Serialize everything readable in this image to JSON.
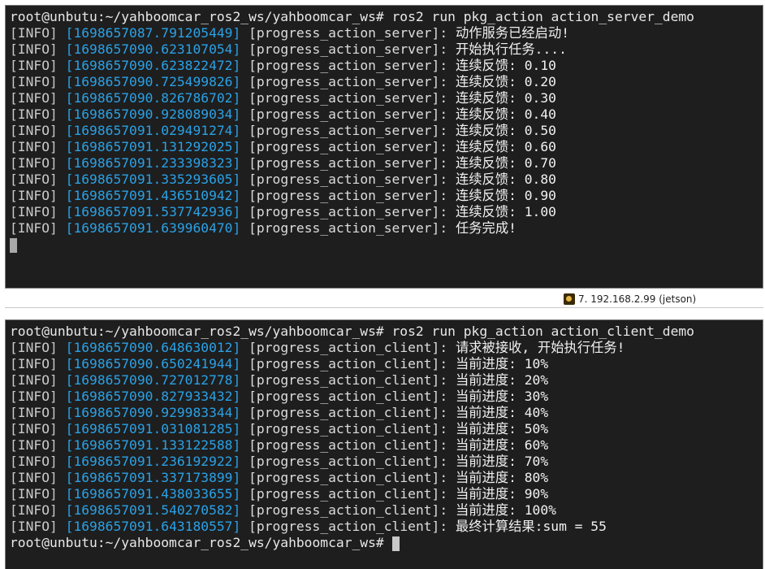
{
  "server": {
    "prompt": "root@unbutu:~/yahboomcar_ros2_ws/yahboomcar_ws#",
    "command": " ros2 run pkg_action action_server_demo",
    "node_name": "[progress_action_server]:",
    "level": "[INFO]",
    "logs": [
      {
        "ts": "[1698657087.791205449]",
        "msg": "动作服务已经启动!"
      },
      {
        "ts": "[1698657090.623107054]",
        "msg": "开始执行任务...."
      },
      {
        "ts": "[1698657090.623822472]",
        "msg": "连续反馈: 0.10"
      },
      {
        "ts": "[1698657090.725499826]",
        "msg": "连续反馈: 0.20"
      },
      {
        "ts": "[1698657090.826786702]",
        "msg": "连续反馈: 0.30"
      },
      {
        "ts": "[1698657090.928089034]",
        "msg": "连续反馈: 0.40"
      },
      {
        "ts": "[1698657091.029491274]",
        "msg": "连续反馈: 0.50"
      },
      {
        "ts": "[1698657091.131292025]",
        "msg": "连续反馈: 0.60"
      },
      {
        "ts": "[1698657091.233398323]",
        "msg": "连续反馈: 0.70"
      },
      {
        "ts": "[1698657091.335293605]",
        "msg": "连续反馈: 0.80"
      },
      {
        "ts": "[1698657091.436510942]",
        "msg": "连续反馈: 0.90"
      },
      {
        "ts": "[1698657091.537742936]",
        "msg": "连续反馈: 1.00"
      },
      {
        "ts": "[1698657091.639960470]",
        "msg": "任务完成!"
      }
    ]
  },
  "statusbar": {
    "session_label": "7. 192.168.2.99 (jetson)",
    "session_icon": "key-icon"
  },
  "client": {
    "prompt": "root@unbutu:~/yahboomcar_ros2_ws/yahboomcar_ws#",
    "command": " ros2 run pkg_action action_client_demo",
    "node_name": "[progress_action_client]:",
    "level": "[INFO]",
    "logs": [
      {
        "ts": "[1698657090.648630012]",
        "msg": "请求被接收, 开始执行任务!"
      },
      {
        "ts": "[1698657090.650241944]",
        "msg": "当前进度: 10%"
      },
      {
        "ts": "[1698657090.727012778]",
        "msg": "当前进度: 20%"
      },
      {
        "ts": "[1698657090.827933432]",
        "msg": "当前进度: 30%"
      },
      {
        "ts": "[1698657090.929983344]",
        "msg": "当前进度: 40%"
      },
      {
        "ts": "[1698657091.031081285]",
        "msg": "当前进度: 50%"
      },
      {
        "ts": "[1698657091.133122588]",
        "msg": "当前进度: 60%"
      },
      {
        "ts": "[1698657091.236192922]",
        "msg": "当前进度: 70%"
      },
      {
        "ts": "[1698657091.337173899]",
        "msg": "当前进度: 80%"
      },
      {
        "ts": "[1698657091.438033655]",
        "msg": "当前进度: 90%"
      },
      {
        "ts": "[1698657091.540270582]",
        "msg": "当前进度: 100%"
      },
      {
        "ts": "[1698657091.643180557]",
        "msg": "最终计算结果:sum = 55"
      }
    ],
    "final_prompt": "root@unbutu:~/yahboomcar_ros2_ws/yahboomcar_ws#"
  },
  "colors": {
    "terminal_bg": "#1e1e1e",
    "timestamp": "#2aa1e6",
    "text": "#dcdcdc"
  }
}
